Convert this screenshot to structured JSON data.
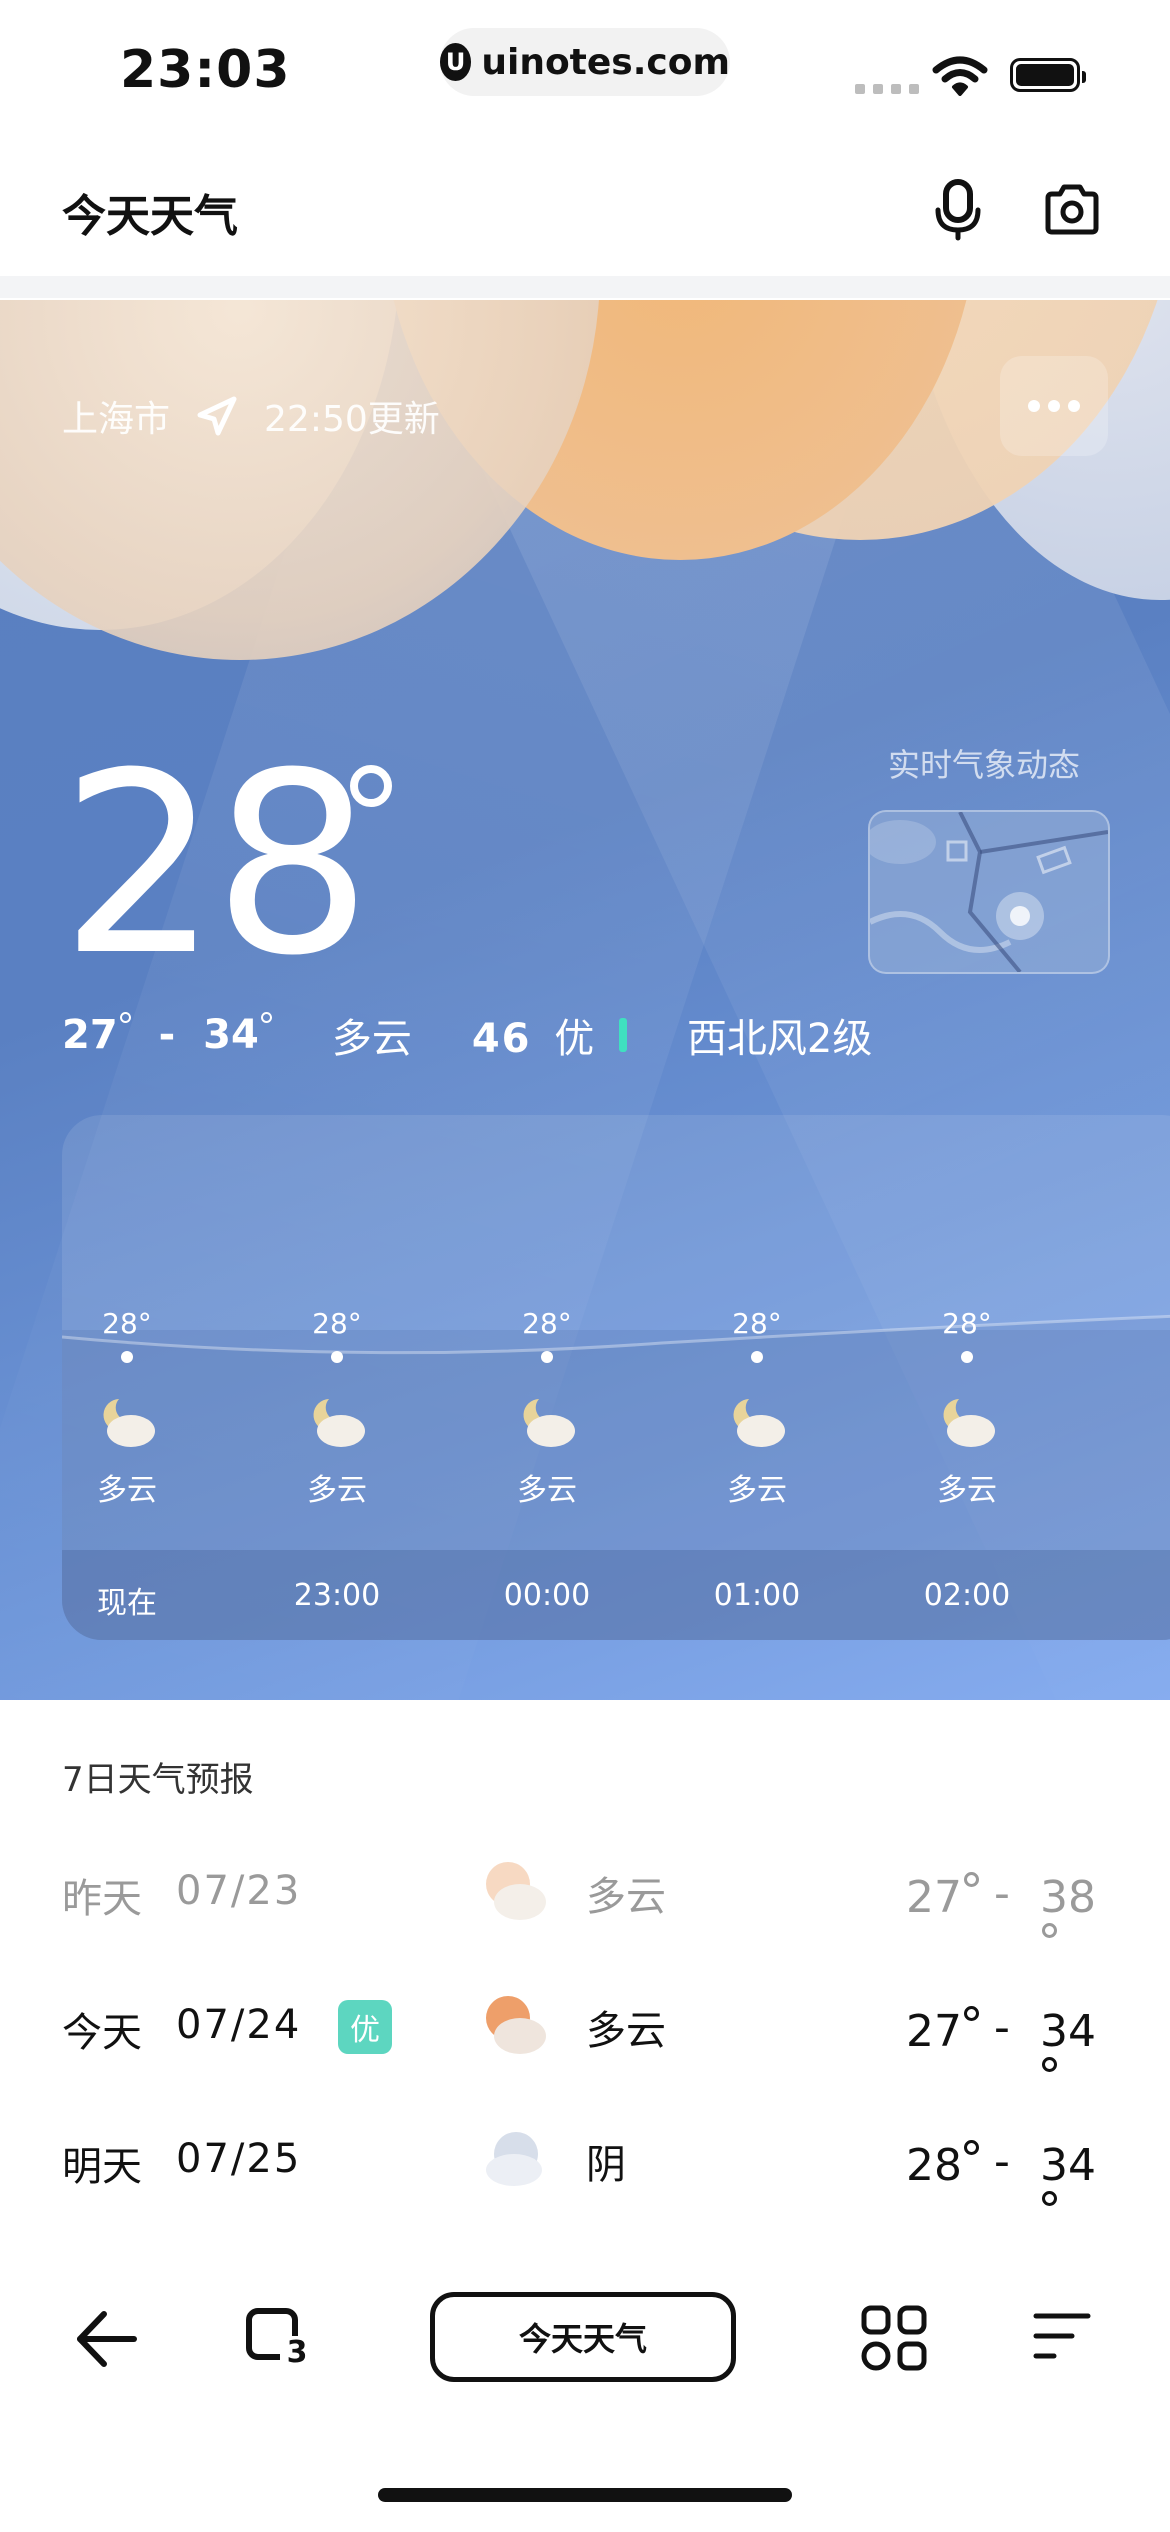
{
  "status_bar": {
    "time": "23:03",
    "url": "uinotes.com",
    "url_logo": "U"
  },
  "header": {
    "title": "今天天气",
    "icons": [
      "microphone-icon",
      "camera-icon"
    ]
  },
  "current": {
    "city": "上海市",
    "updated": "22:50更新",
    "temperature": "28",
    "range_low": "27",
    "range_separator": "-",
    "range_high": "34",
    "condition": "多云",
    "aqi_value": "46",
    "aqi_level": "优",
    "wind": "西北风2级",
    "realtime_label": "实时气象动态"
  },
  "hourly": [
    {
      "temp": "28°",
      "condition": "多云",
      "time": "现在"
    },
    {
      "temp": "28°",
      "condition": "多云",
      "time": "23:00"
    },
    {
      "temp": "28°",
      "condition": "多云",
      "time": "00:00"
    },
    {
      "temp": "28°",
      "condition": "多云",
      "time": "01:00"
    },
    {
      "temp": "28°",
      "condition": "多云",
      "time": "02:00"
    }
  ],
  "forecast": {
    "title": "7日天气预报",
    "days": [
      {
        "day": "昨天",
        "date": "07/23",
        "condition": "多云",
        "low": "27",
        "high": "38",
        "badge": ""
      },
      {
        "day": "今天",
        "date": "07/24",
        "condition": "多云",
        "low": "27",
        "high": "34",
        "badge": "优"
      },
      {
        "day": "明天",
        "date": "07/25",
        "condition": "阴",
        "low": "28",
        "high": "34",
        "badge": ""
      }
    ]
  },
  "bottom_bar": {
    "search_label": "今天天气",
    "tab_count": "3"
  },
  "colors": {
    "aqi_good": "#3fe0c0",
    "badge_good": "#5dd6c0",
    "hero_blue": "#5a80c2"
  }
}
